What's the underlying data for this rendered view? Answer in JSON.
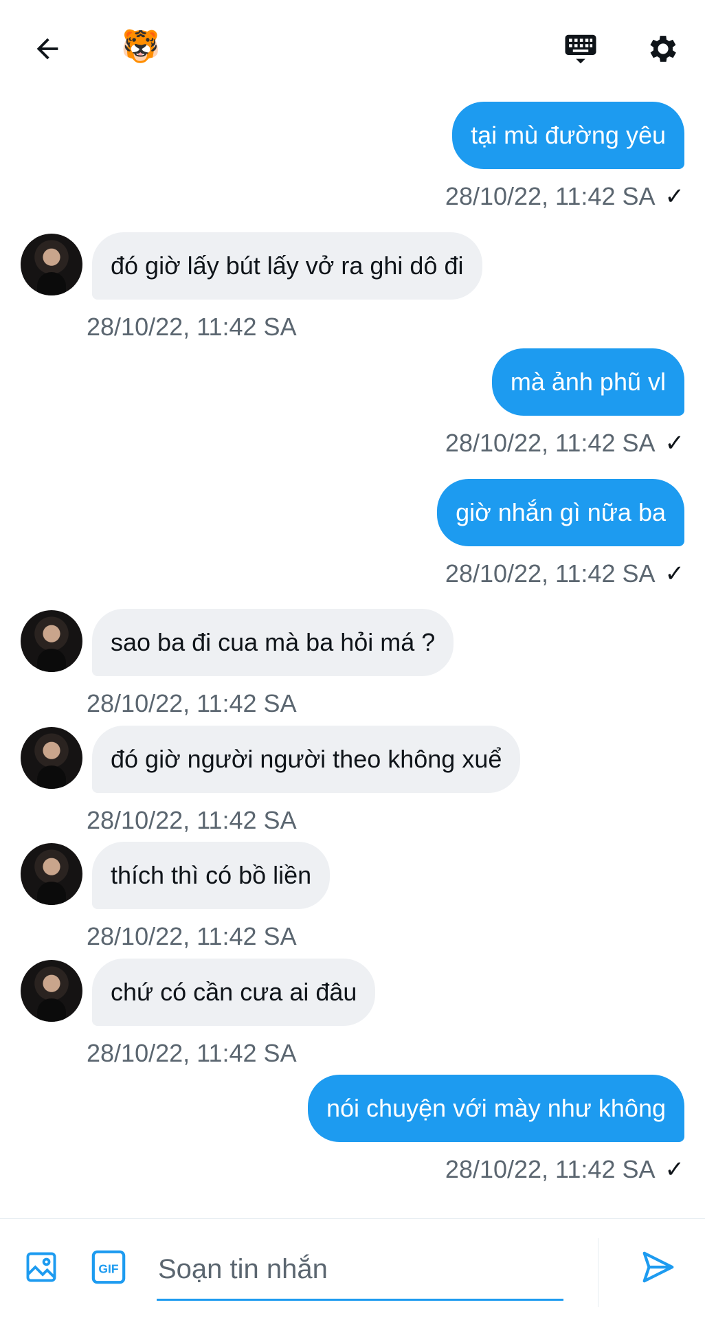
{
  "header": {
    "avatar_emoji": "🐯",
    "colors": {
      "icon": "#0f1419"
    },
    "icons": [
      "back-arrow-icon",
      "keyboard-icon",
      "gear-icon"
    ]
  },
  "messages": [
    {
      "direction": "sent",
      "text": "tại mù đường yêu",
      "time": "28/10/22, 11:42 SA",
      "status": "✓"
    },
    {
      "direction": "received",
      "text": "đó giờ lấy bút lấy vở ra ghi dô đi",
      "time": "28/10/22, 11:42 SA"
    },
    {
      "direction": "sent",
      "text": "mà ảnh phũ vl",
      "time": "28/10/22, 11:42 SA",
      "status": "✓"
    },
    {
      "direction": "sent",
      "text": "giờ nhắn gì nữa ba",
      "time": "28/10/22, 11:42 SA",
      "status": "✓"
    },
    {
      "direction": "received",
      "text": "sao ba đi cua mà ba hỏi má ?",
      "time": "28/10/22, 11:42 SA"
    },
    {
      "direction": "received",
      "text": "đó giờ người người theo không xuể",
      "time": "28/10/22, 11:42 SA"
    },
    {
      "direction": "received",
      "text": "thích thì có bồ liền",
      "time": "28/10/22, 11:42 SA"
    },
    {
      "direction": "received",
      "text": "chứ có cần cưa ai đâu",
      "time": "28/10/22, 11:42 SA"
    },
    {
      "direction": "sent",
      "text": "nói chuyện với mày như không",
      "time": "28/10/22, 11:42 SA",
      "status": "✓"
    }
  ],
  "composer": {
    "placeholder": "Soạn tin nhắn",
    "value": "",
    "gif_label": "GIF",
    "colors": {
      "accent": "#1d9bf0"
    },
    "icons": [
      "image-icon",
      "gif-icon",
      "send-icon"
    ]
  },
  "theme": {
    "sent_bubble": "#1d9bf0",
    "received_bubble": "#eef0f3",
    "meta_text": "#5b6670"
  }
}
